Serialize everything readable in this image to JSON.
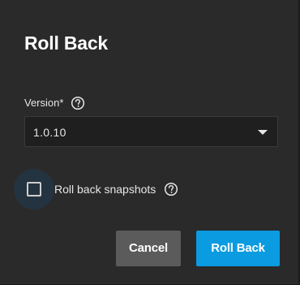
{
  "dialog": {
    "title": "Roll Back"
  },
  "version_field": {
    "label": "Version",
    "required_marker": "*",
    "selected_value": "1.0.10",
    "icon": "chevron-down-icon"
  },
  "snapshots_option": {
    "label": "Roll back snapshots",
    "checked": false
  },
  "help_icon": "help-circle-icon",
  "actions": {
    "cancel_label": "Cancel",
    "confirm_label": "Roll Back"
  },
  "colors": {
    "dialog_bg": "#2a2a2a",
    "primary": "#0b9be0",
    "cancel_bg": "#5b5b5b",
    "text": "#e6e6e6"
  }
}
